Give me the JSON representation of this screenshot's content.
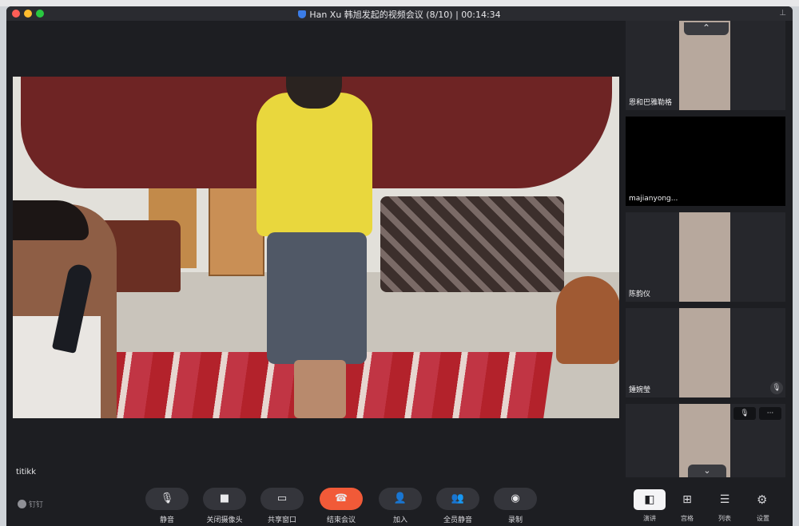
{
  "window": {
    "title": "Han Xu 韩旭发起的视频会议 (8/10) | 00:14:34"
  },
  "main": {
    "speaker_name": "titikk"
  },
  "participants": [
    {
      "name": "恩和巴雅勒格"
    },
    {
      "name": "majianyong..."
    },
    {
      "name": "陈韵仪"
    },
    {
      "name": "鍾婉瑩"
    },
    {
      "name": ""
    }
  ],
  "thumb_controls": {
    "up_arrow": "⌃",
    "down_arrow": "⌄",
    "more": "···"
  },
  "toolbar": {
    "brand": "钉钉",
    "mute": "静音",
    "camera_off": "关闭摄像头",
    "share_window": "共享窗口",
    "end_meeting": "结束会议",
    "add_person": "加入",
    "mute_all": "全员静音",
    "record": "录制",
    "view_speaker": "演讲",
    "view_grid": "宫格",
    "view_list": "列表",
    "settings": "设置"
  },
  "colors": {
    "end_button": "#f15a38",
    "background": "#1d1e22"
  }
}
